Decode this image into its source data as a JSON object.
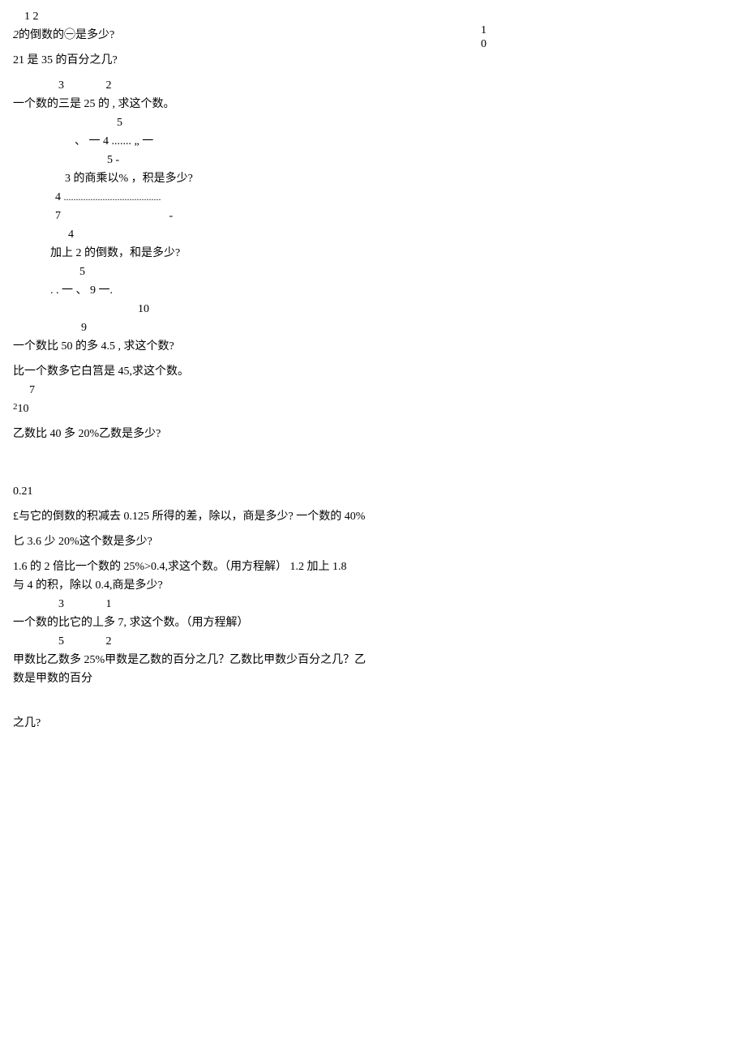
{
  "toprightA": "1",
  "toprightB": "0",
  "l1": "1 2",
  "l2a": "2",
  "l2b": "的倒数的㊀是多少?",
  "l3": "21 是 35 的百分之几?",
  "l4a": "3",
  "l4b": "2",
  "l5": "一个数的三是 25 的  , 求这个数。",
  "l6": "5",
  "l7": "、 一  4   .......  „ 一",
  "l8": "5 -",
  "l9": "3 的商乘以% ，积是多少?",
  "l10a": "4",
  "l10b": "........................................",
  "l11": "7",
  "l11b": "-",
  "l12": "4",
  "l13": "加上 2 的倒数，和是多少?",
  "l14": "5",
  "l15": ". .   一  、 9 一.",
  "l16": "10",
  "l17": "9",
  "l18": "一个数比 50 的多 4.5 , 求这个数?",
  "l19": "比一个数多它白筥是 45,求这个数。",
  "l20": "7",
  "l21a": "2",
  "l21b": "10",
  "l22": "乙数比 40 多 20%乙数是多少?",
  "l23": "0.21",
  "l24": "£与它的倒数的积减去 0.125 所得的差，除以，商是多少?  一个数的 40%",
  "l25": "匕 3.6 少 20%这个数是多少?",
  "l26": "1.6 的 2 倍比一个数的 25%>0.4,求这个数。（用方程解）   1.2 加上 1.8",
  "l27": "与 4 的积，除以 0.4,商是多少?",
  "l28a": "3",
  "l28b": "1",
  "l29": "一个数的比它的丄多 7, 求这个数。（用方程解）",
  "l30a": "5",
  "l30b": "2",
  "l31": "甲数比乙数多 25%甲数是乙数的百分之几？乙数比甲数少百分之几？乙",
  "l32": "数是甲数的百分",
  "l33": "之几?"
}
